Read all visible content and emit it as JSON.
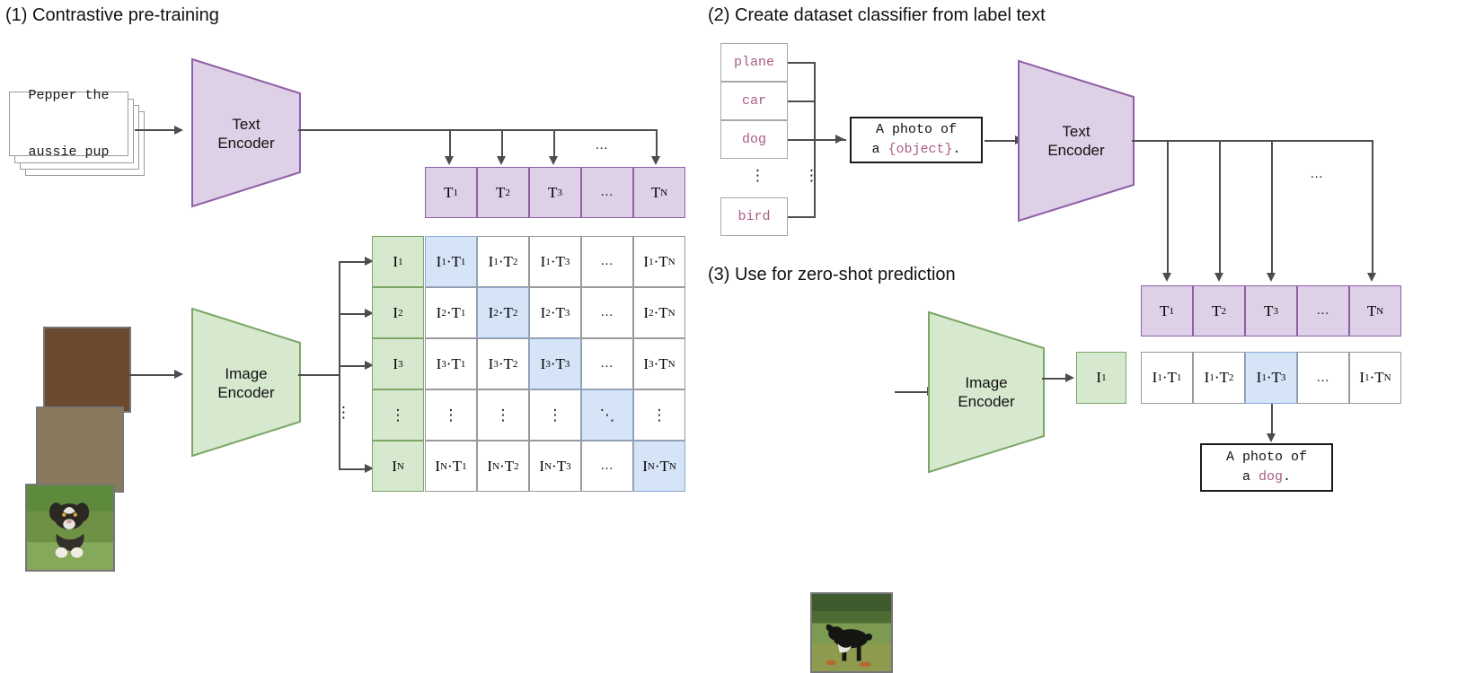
{
  "sections": {
    "one": {
      "title": "(1) Contrastive pre-training"
    },
    "two": {
      "title": "(2) Create dataset classifier from label text"
    },
    "three": {
      "title": "(3) Use for zero-shot prediction"
    }
  },
  "encoders": {
    "text": {
      "line1": "Text",
      "line2": "Encoder"
    },
    "image": {
      "line1": "Image",
      "line2": "Encoder"
    }
  },
  "pretrain": {
    "caption_card": {
      "line1": "Pepper the",
      "line2": "aussie pup"
    },
    "image_alt": "aussie-puppy-photo",
    "text_embeddings": [
      "T",
      "T",
      "T",
      "…",
      "T"
    ],
    "text_embeddings_sub": [
      "1",
      "2",
      "3",
      "",
      "N"
    ],
    "image_embeddings": [
      "I",
      "I",
      "I",
      "⋮",
      "I"
    ],
    "image_embeddings_sub": [
      "1",
      "2",
      "3",
      "",
      "N"
    ],
    "ellipsis": "...",
    "vdots": "⋮",
    "ddots": "⋱",
    "matrix_rows": [
      {
        "row_label": "1",
        "cells": [
          {
            "i": "1",
            "t": "1",
            "highlight": true
          },
          {
            "i": "1",
            "t": "2",
            "highlight": false
          },
          {
            "i": "1",
            "t": "3",
            "highlight": false
          },
          {
            "dots": "...",
            "highlight": false
          },
          {
            "i": "1",
            "t": "N",
            "highlight": false
          }
        ]
      },
      {
        "row_label": "2",
        "cells": [
          {
            "i": "2",
            "t": "1",
            "highlight": false
          },
          {
            "i": "2",
            "t": "2",
            "highlight": true
          },
          {
            "i": "2",
            "t": "3",
            "highlight": false
          },
          {
            "dots": "...",
            "highlight": false
          },
          {
            "i": "2",
            "t": "N",
            "highlight": false
          }
        ]
      },
      {
        "row_label": "3",
        "cells": [
          {
            "i": "3",
            "t": "1",
            "highlight": false
          },
          {
            "i": "3",
            "t": "2",
            "highlight": false
          },
          {
            "i": "3",
            "t": "3",
            "highlight": true
          },
          {
            "dots": "...",
            "highlight": false
          },
          {
            "i": "3",
            "t": "N",
            "highlight": false
          }
        ]
      },
      {
        "row_label": "",
        "cells": [
          {
            "dots": "⋮",
            "highlight": false
          },
          {
            "dots": "⋮",
            "highlight": false
          },
          {
            "dots": "⋮",
            "highlight": false
          },
          {
            "dots": "⋱",
            "highlight": true
          },
          {
            "dots": "⋮",
            "highlight": false
          }
        ]
      },
      {
        "row_label": "N",
        "cells": [
          {
            "i": "N",
            "t": "1",
            "highlight": false
          },
          {
            "i": "N",
            "t": "2",
            "highlight": false
          },
          {
            "i": "N",
            "t": "3",
            "highlight": false
          },
          {
            "dots": "...",
            "highlight": false
          },
          {
            "i": "N",
            "t": "N",
            "highlight": true
          }
        ]
      }
    ]
  },
  "classifier": {
    "labels": [
      "plane",
      "car",
      "dog",
      "bird"
    ],
    "label_vdots": "⋮",
    "connector_vdots": "⋮",
    "prompt": {
      "line1": "A photo of",
      "prefix2": "a ",
      "object": "{object}",
      "suffix2": "."
    },
    "text_embeddings_sub": [
      "1",
      "2",
      "3",
      "",
      "N"
    ],
    "ellipsis": "..."
  },
  "zeroshot": {
    "image_alt": "black-dog-in-field-photo",
    "image_embedding": {
      "base": "I",
      "sub": "1"
    },
    "scores": [
      {
        "i": "1",
        "t": "1",
        "highlight": false
      },
      {
        "i": "1",
        "t": "2",
        "highlight": false
      },
      {
        "i": "1",
        "t": "3",
        "highlight": true
      },
      {
        "dots": "...",
        "highlight": false
      },
      {
        "i": "1",
        "t": "N",
        "highlight": false
      }
    ],
    "prediction": {
      "line1": "A photo of",
      "prefix2": "a ",
      "object": "dog",
      "suffix2": "."
    }
  },
  "colors": {
    "purple_fill": "#ded0e6",
    "purple_stroke": "#8f5fa8",
    "green_fill": "#d6e8ce",
    "green_stroke": "#7aa765",
    "blue_fill": "#d6e4f7",
    "blue_stroke": "#8aa9d6",
    "pink_text": "#ab5d86",
    "line": "#4d4d4d"
  }
}
